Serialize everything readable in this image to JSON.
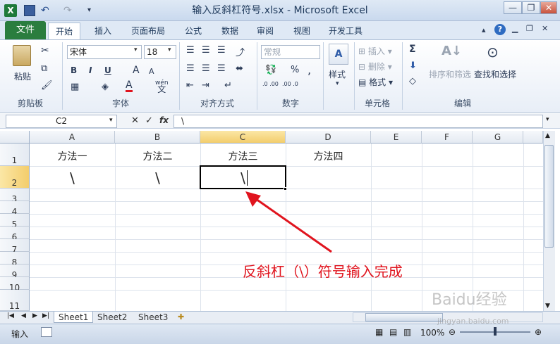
{
  "title": "输入反斜杠符号.xlsx - Microsoft Excel",
  "menu": {
    "file": "文件",
    "tabs": [
      "开始",
      "插入",
      "页面布局",
      "公式",
      "数据",
      "审阅",
      "视图",
      "开发工具"
    ]
  },
  "ribbon": {
    "clipboard": {
      "paste": "粘贴",
      "label": "剪贴板"
    },
    "font": {
      "name": "宋体",
      "size": "18",
      "label": "字体",
      "bold": "B",
      "italic": "I",
      "underline": "U",
      "grow": "A",
      "shrink": "A",
      "color": "A",
      "wen": "wén",
      "wen_char": "文"
    },
    "align": {
      "label": "对齐方式"
    },
    "number": {
      "format": "常规",
      "label": "数字",
      "percent": "%",
      "comma": ",",
      "inc": ".0 .00",
      "dec": ".00 .0"
    },
    "styles": {
      "label": "样式"
    },
    "cells": {
      "insert": "插入",
      "delete": "删除",
      "format": "格式",
      "label": "单元格"
    },
    "editing": {
      "sigma": "Σ",
      "sort": "排序和筛选",
      "find": "查找和选择",
      "label": "编辑"
    }
  },
  "formula_bar": {
    "name_box": "C2",
    "fx": "fx",
    "content": "\\"
  },
  "columns": [
    "A",
    "B",
    "C",
    "D",
    "E",
    "F",
    "G"
  ],
  "rows": [
    "1",
    "2",
    "3",
    "4",
    "5",
    "6",
    "7",
    "8",
    "9",
    "10",
    "11"
  ],
  "cells": {
    "A1": "方法一",
    "B1": "方法二",
    "C1": "方法三",
    "D1": "方法四",
    "A2": "\\",
    "B2": "\\",
    "C2": "\\"
  },
  "sheets": [
    "Sheet1",
    "Sheet2",
    "Sheet3"
  ],
  "status": {
    "mode": "输入",
    "zoom": "100%"
  },
  "annotation": "反斜杠（\\）符号输入完成",
  "watermark": "Baidu经验",
  "watermark_url": "jingyan.baidu.com",
  "colors": {
    "file_tab": "#2a7d3e",
    "annotation": "#e0141e",
    "selected_header": "#f3cd6c"
  }
}
